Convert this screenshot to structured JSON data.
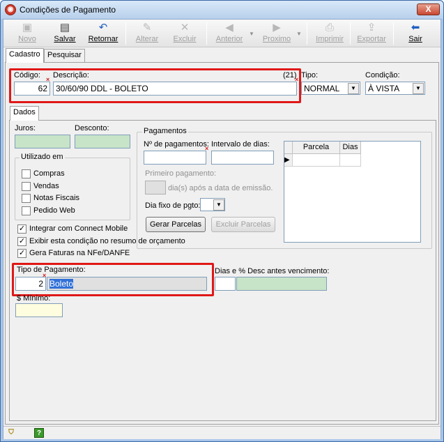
{
  "window": {
    "title": "Condições de Pagamento",
    "close_label": "X"
  },
  "toolbar": {
    "novo": "Novo",
    "salvar": "Salvar",
    "retornar": "Retornar",
    "alterar": "Alterar",
    "excluir": "Excluir",
    "anterior": "Anterior",
    "proximo": "Proximo",
    "imprimir": "Imprimir",
    "exportar": "Exportar",
    "sair": "Sair"
  },
  "tabs": {
    "cadastro": "Cadastro",
    "pesquisar": "Pesquisar",
    "dados": "Dados"
  },
  "header_fields": {
    "codigo_label": "Código:",
    "codigo_value": "62",
    "descricao_label": "Descrição:",
    "descricao_count": "(21)",
    "descricao_value": "30/60/90 DDL - BOLETO",
    "tipo_label": "Tipo:",
    "tipo_value": "NORMAL",
    "condicao_label": "Condição:",
    "condicao_value": "À VISTA"
  },
  "dados": {
    "juros_label": "Juros:",
    "juros_value": "",
    "desconto_label": "Desconto:",
    "desconto_value": "",
    "utilizado_em_title": "Utilizado em",
    "utilizado_em": [
      {
        "label": "Compras",
        "checked": false
      },
      {
        "label": "Vendas",
        "checked": false
      },
      {
        "label": "Notas Fiscais",
        "checked": false
      },
      {
        "label": "Pedido Web",
        "checked": false
      }
    ],
    "options": [
      {
        "label": "Integrar com Connect Mobile",
        "checked": true
      },
      {
        "label": "Exibir esta condição no resumo de orçamento",
        "checked": true
      },
      {
        "label": "Gera Faturas na NFe/DANFE",
        "checked": true
      }
    ],
    "tipo_pagamento_label": "Tipo de Pagamento:",
    "tipo_pagamento_code": "2",
    "tipo_pagamento_name": "Boleto",
    "minimo_label": "$ Mínimo:",
    "minimo_value": "",
    "dias_desc_label": "Dias e % Desc antes vencimento:"
  },
  "pagamentos": {
    "title": "Pagamentos",
    "n_pagamentos_label": "Nº de pagamentos:",
    "intervalo_label": "Intervalo de dias:",
    "primeiro_label": "Primeiro pagamento:",
    "dias_apos_label": "dia(s) após a data de emissão.",
    "dia_fixo_label": "Dia fixo de pgto:",
    "gerar_button": "Gerar Parcelas",
    "excluir_button": "Excluir Parcelas",
    "grid_headers": [
      "Parcela",
      "Dias"
    ],
    "row_indicator": "▶"
  },
  "statusbar": {
    "help_label": "?"
  },
  "colors": {
    "highlight_red": "#e01818",
    "green_field": "#c8e4c8",
    "yellow_field": "#fffde0",
    "selection_blue": "#3070d8"
  }
}
